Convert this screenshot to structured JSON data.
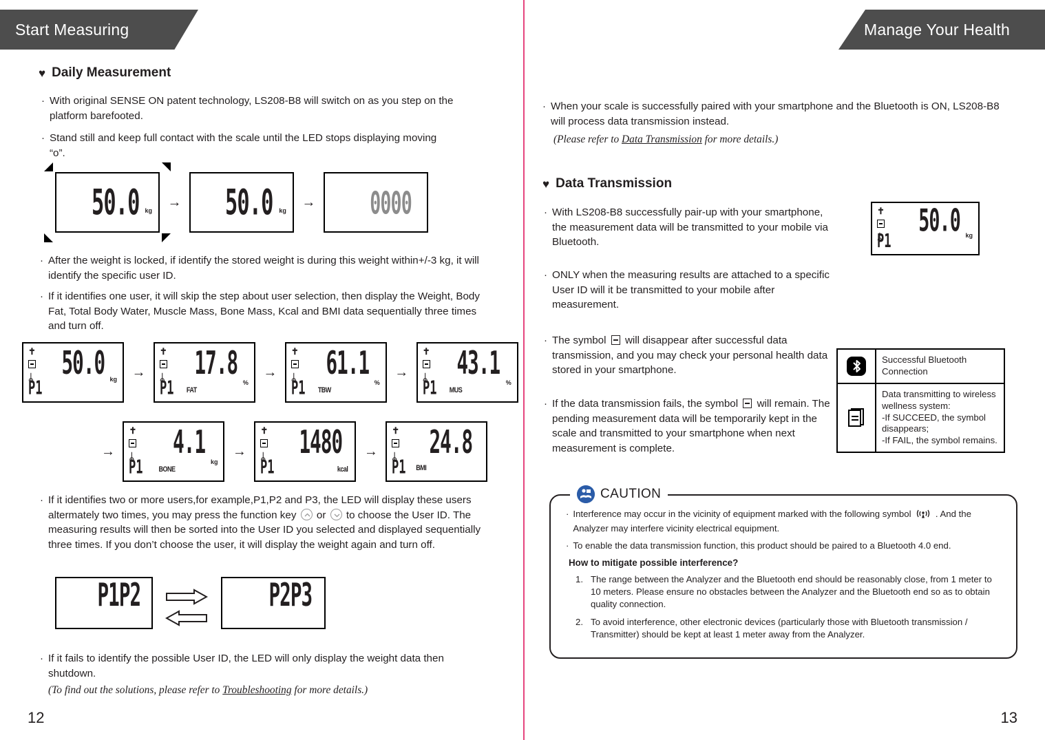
{
  "left_page": {
    "banner": "Start Measuring",
    "section_title": "Daily Measurement",
    "bullets": [
      "With original SENSE ON patent technology, LS208-B8 will switch on as you step on the platform barefooted.",
      "Stand still and keep full contact with the scale until the LED stops displaying moving “o”.",
      "After the weight is locked, if identify the stored weight is during this weight within+/-3 kg, it will identify the specific user ID.",
      "If it identifies one user, it will skip the step about user selection, then display the Weight, Body Fat, Total Body Water, Muscle Mass, Bone Mass, Kcal and BMI data sequentially three times and turn off."
    ],
    "user_select_text_a": "If it identifies two or more users,for example,P1,P2 and P3, the LED will display these users altermately two times, you may press the function key",
    "user_select_text_b": "or",
    "user_select_text_c": "to choose the User ID. The measuring results will then be sorted into the User ID you selected and displayed sequentially three times. If you don’t choose the user, it will display the weight again and turn off.",
    "fail_bullet": "If it fails to identify the possible User ID, the LED will only display the weight data then shutdown.",
    "fail_note_pre": "(To find out the solutions, please refer to ",
    "fail_note_link": "Troubleshooting",
    "fail_note_post": " for more details.)",
    "page_number": "12",
    "boot_sequence": [
      {
        "value": "50.0",
        "unit": "kg",
        "arrows": true
      },
      {
        "value": "50.0",
        "unit": "kg",
        "arrows": false
      },
      {
        "value": "0000",
        "unit": "",
        "arrows": false
      }
    ],
    "metrics_row1": [
      {
        "value": "50.0",
        "unit": "kg",
        "metric": "",
        "pid": "P1"
      },
      {
        "value": "17.8",
        "unit": "%",
        "metric": "FAT",
        "pid": "P1"
      },
      {
        "value": "61.1",
        "unit": "%",
        "metric": "TBW",
        "pid": "P1"
      },
      {
        "value": "43.1",
        "unit": "%",
        "metric": "MUS",
        "pid": "P1"
      }
    ],
    "metrics_row2": [
      {
        "value": "4.1",
        "unit": "kg",
        "metric": "BONE",
        "pid": "P1"
      },
      {
        "value": "1480",
        "unit": "",
        "metric": "kcal",
        "pid": "P1"
      },
      {
        "value": "24.8",
        "unit": "",
        "metric": "BMI",
        "pid": "P1"
      }
    ],
    "user_displays": {
      "left": "P1P2",
      "right": "P2P3"
    }
  },
  "right_page": {
    "banner": "Manage Your Health",
    "top_bullet": "When your scale is successfully paired with your smartphone and the Bluetooth is ON, LS208-B8 will process data transmission instead.",
    "top_note_pre": "(Please refer to ",
    "top_note_link": "Data Transmission",
    "top_note_post": " for more details.)",
    "section_title": "Data Transmission",
    "bullets": [
      "With LS208-B8 successfully pair-up with your smartphone, the measurement data will be transmitted to your mobile via Bluetooth.",
      "ONLY when the measuring results are attached to a specific User ID will it be transmitted to your mobile after measurement."
    ],
    "symbol_bullet_a_pre": "The symbol",
    "symbol_bullet_a_post": "will disappear after successful data transmission, and you may check your personal health data stored in your smartphone.",
    "symbol_bullet_b_pre": "If the data transmission fails, the symbol",
    "symbol_bullet_b_post": "will remain. The pending measurement data will be temporarily kept in the scale and transmitted to your smartphone when next measurement is complete.",
    "display": {
      "value": "50.0",
      "unit": "kg",
      "pid": "P1"
    },
    "legend": [
      {
        "icon": "bluetooth-icon",
        "text": "Successful Bluetooth Connection"
      },
      {
        "icon": "document-icon",
        "text": "Data transmitting to wireless wellness system:\n-If SUCCEED, the symbol disappears;\n-If FAIL, the symbol remains."
      }
    ],
    "caution": {
      "label": "CAUTION",
      "bullet1_pre": "Interference may occur in the vicinity of equipment marked with the following symbol",
      "bullet1_post": ". And the Analyzer may interfere vicinity electrical equipment.",
      "bullet2": "To enable the data transmission function, this product should be paired to a Bluetooth 4.0 end.",
      "question": "How to mitigate possible interference?",
      "items": [
        {
          "n": "1.",
          "text": "The range between the Analyzer and the Bluetooth end should be reasonably close, from 1 meter to 10 meters. Please ensure no obstacles between the Analyzer and the Bluetooth end so as to obtain quality connection."
        },
        {
          "n": "2.",
          "text": "To avoid interference, other electronic devices (particularly those with Bluetooth transmission / Transmitter) should be kept at least 1 meter away from the Analyzer."
        }
      ]
    },
    "page_number": "13"
  },
  "glyphs": {
    "heart": "♥",
    "bullet_dot": "·",
    "arrow_right": "→",
    "bluetooth": "ᛦ",
    "person": "✝"
  },
  "colors": {
    "banner_bg": "#4d4d4d",
    "banner_text": "#ffffff",
    "divider": "#e5447e",
    "body_text": "#231f20",
    "caution_icon": "#2b5ca8"
  }
}
